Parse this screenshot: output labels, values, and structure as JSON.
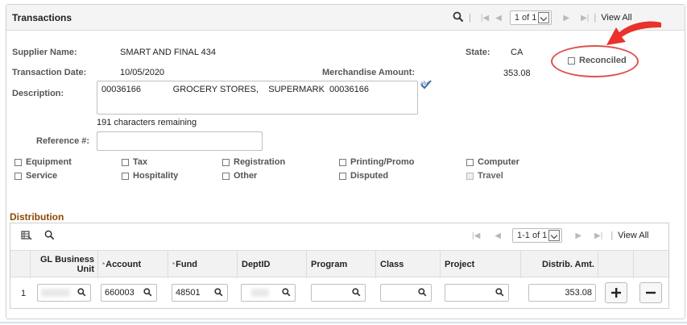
{
  "panel": {
    "title": "Transactions",
    "pager": "1 of 1",
    "view_all": "View All"
  },
  "fields": {
    "supplier_name_label": "Supplier Name:",
    "supplier_name": "SMART AND FINAL 434",
    "state_label": "State:",
    "state": "CA",
    "transaction_date_label": "Transaction Date:",
    "transaction_date": "10/05/2020",
    "merch_amount_label": "Merchandise Amount:",
    "merch_amount": "353.08",
    "reconciled_label": "Reconciled",
    "description_label": "Description:",
    "description_value": "00036166             GROCERY STORES,    SUPERMARK  00036166",
    "chars_remaining": "191 characters remaining",
    "reference_label": "Reference #:",
    "reference_value": ""
  },
  "checkboxes": {
    "equipment": "Equipment",
    "tax": "Tax",
    "registration": "Registration",
    "printing": "Printing/Promo",
    "computer": "Computer",
    "service": "Service",
    "hospitality": "Hospitality",
    "other": "Other",
    "disputed": "Disputed",
    "travel": "Travel"
  },
  "distribution": {
    "title": "Distribution",
    "pager": "1-1 of 1",
    "view_all": "View All",
    "columns": {
      "gl_bu_line1": "GL Business",
      "gl_bu_line2": "Unit",
      "account": "Account",
      "fund": "Fund",
      "deptid": "DeptID",
      "program": "Program",
      "class": "Class",
      "project": "Project",
      "distrib_amt": "Distrib. Amt."
    },
    "row": {
      "num": "1",
      "account": "660003",
      "fund": "48501",
      "amount": "353.08"
    }
  },
  "colors": {
    "section_title": "#8a4a00",
    "callout": "#e0504c",
    "arrow": "#e8322b"
  }
}
